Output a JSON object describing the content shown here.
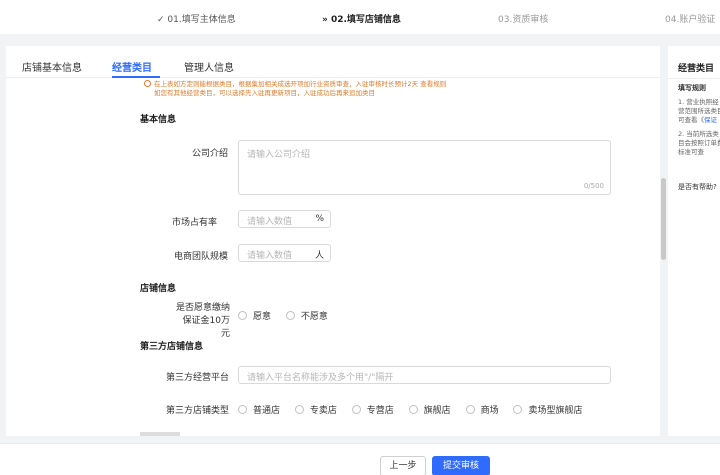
{
  "steps": [
    {
      "label": "✓ 01.填写主体信息",
      "state": "done"
    },
    {
      "label": "» 02.填写店铺信息",
      "state": "active"
    },
    {
      "label": "03.资质审核",
      "state": "future"
    },
    {
      "label": "04.账户验证",
      "state": "future"
    }
  ],
  "tabs": [
    {
      "label": "店铺基本信息"
    },
    {
      "label": "经营类目"
    },
    {
      "label": "管理人信息"
    }
  ],
  "notice": {
    "line1": "在上表如方定则能根据类目，根据集加相关成选开项加行业资质审查，入驻审核时长预计2天 查看规则",
    "line2": "如您有其他经营类目，可以选择先入驻再更新项目，入驻成功后再来追加类目"
  },
  "sections": {
    "basic": "基本信息",
    "store": "店铺信息",
    "third_party": "第三方店铺信息"
  },
  "fields": {
    "company_intro": {
      "label": "公司介绍",
      "placeholder": "请输入公司介绍",
      "counter": "0/500"
    },
    "market_share": {
      "label": "市场占有率",
      "placeholder": "请输入数值",
      "suffix": "%"
    },
    "team_size": {
      "label": "电商团队规模",
      "placeholder": "请输入数值",
      "suffix": "人"
    },
    "deposit": {
      "label": "是否愿意缴纳保证金10万元",
      "options": [
        "愿意",
        "不愿意"
      ]
    },
    "platform": {
      "label": "第三方经营平台",
      "placeholder": "请输入平台名称能涉及多个用\"/\"隔开"
    },
    "store_type": {
      "label": "第三方店铺类型",
      "options": [
        "普通店",
        "专卖店",
        "专营店",
        "旗舰店",
        "商场",
        "卖场型旗舰店"
      ]
    }
  },
  "sidebar": {
    "title": "经营类目",
    "subtitle": "填写规则",
    "rule1_pre": "1. 营业执照经营范围所选类目可查看《",
    "rule1_link": "保证",
    "rule2": "2. 当前所选类目会按照订单费标准可查",
    "help": "是否有帮助?"
  },
  "footer": {
    "prev_label": "上一步",
    "submit_label": "提交审核"
  },
  "colors": {
    "accent": "#2f6bff",
    "notice": "#e07b2a"
  }
}
